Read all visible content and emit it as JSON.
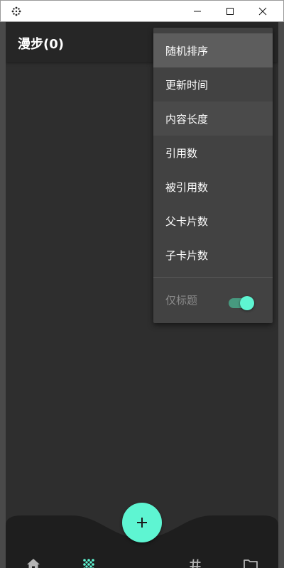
{
  "page": {
    "title": "漫步(0)"
  },
  "sort_menu": {
    "items": [
      {
        "label": "随机排序"
      },
      {
        "label": "更新时间"
      },
      {
        "label": "内容长度"
      },
      {
        "label": "引用数"
      },
      {
        "label": "被引用数"
      },
      {
        "label": "父卡片数"
      },
      {
        "label": "子卡片数"
      }
    ],
    "title_only": {
      "label": "仅标题",
      "enabled": true
    }
  },
  "bottom_nav": {
    "items": [
      {
        "icon": "home-icon"
      },
      {
        "icon": "shuffle-dots-icon",
        "active": true
      },
      {
        "icon": "add-icon"
      },
      {
        "icon": "hashtag-icon"
      },
      {
        "icon": "folder-icon"
      }
    ]
  },
  "colors": {
    "accent": "#5ef5d2",
    "background": "#2e2e2e",
    "menu": "#424242"
  }
}
